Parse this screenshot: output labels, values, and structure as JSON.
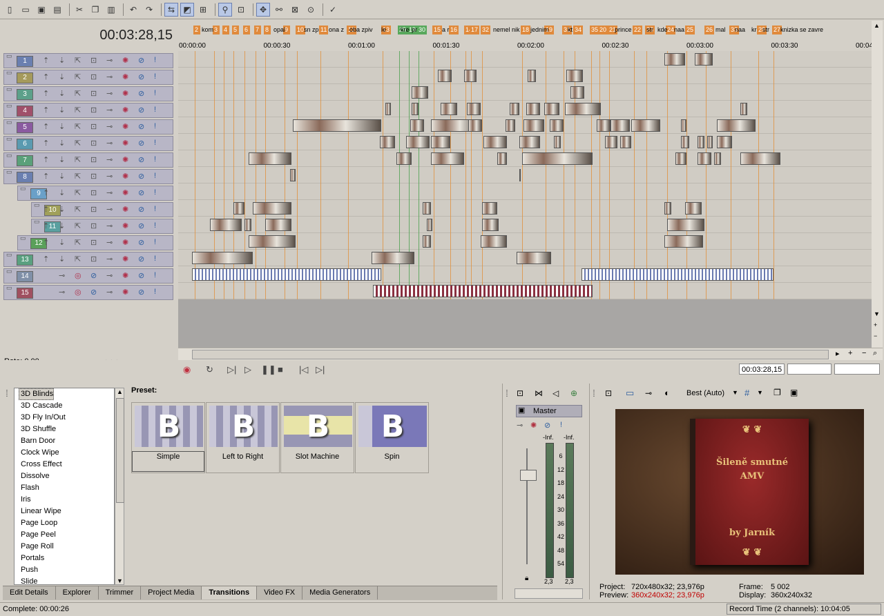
{
  "toolbar": {
    "icons": [
      "new-icon",
      "open-icon",
      "save-icon",
      "properties-icon",
      "cut-icon",
      "copy-icon",
      "paste-icon",
      "undo-icon",
      "redo-icon",
      "normal-edit-tool-icon",
      "envelope-tool-icon",
      "selection-tool-icon",
      "snapping-icon",
      "auto-ripple-icon",
      "lock-envelopes-icon",
      "ignore-grouping-icon",
      "zoom-tool-icon",
      "crossfade-icon"
    ]
  },
  "timeline": {
    "cursor_time": "00:03:28,15",
    "rate_label": "Rate: 0,00",
    "ruler_ticks": [
      "00:00:00",
      "00:00:30",
      "00:01:00",
      "00:01:30",
      "00:02:00",
      "00:02:30",
      "00:03:00",
      "00:03:30",
      "00:04:0"
    ],
    "markers": [
      "2",
      "3",
      "4",
      "5",
      "6",
      "7",
      "8",
      "9",
      "10",
      "11",
      "12",
      "13",
      "29",
      "19",
      "30",
      "15",
      "16",
      "14",
      "17",
      "32",
      "18",
      "19",
      "31",
      "34",
      "35",
      "20",
      "21",
      "22",
      "23",
      "24",
      "25",
      "26",
      "33",
      "28",
      "27"
    ],
    "marker_texts": [
      "kom",
      "opal",
      "sn zp",
      "ona z",
      "oba zpiv",
      "le",
      "kre",
      "pr",
      "a r",
      "nemel nik",
      "jednim",
      "kt",
      "prince",
      "str",
      "kde",
      "naa",
      "mal",
      "naa",
      "kr",
      "str",
      "knizka se zavre"
    ],
    "tracks": [
      "1",
      "2",
      "3",
      "4",
      "5",
      "6",
      "7",
      "8",
      "9",
      "10",
      "11",
      "12",
      "13",
      "14",
      "15"
    ],
    "transport_time": "00:03:28,15"
  },
  "transitions": {
    "preset_label": "Preset:",
    "list": [
      "3D Blinds",
      "3D Cascade",
      "3D Fly In/Out",
      "3D Shuffle",
      "Barn Door",
      "Clock Wipe",
      "Cross Effect",
      "Dissolve",
      "Flash",
      "Iris",
      "Linear Wipe",
      "Page Loop",
      "Page Peel",
      "Page Roll",
      "Portals",
      "Push",
      "Slide"
    ],
    "selected": "3D Blinds",
    "presets": [
      "Simple",
      "Left to Right",
      "Slot Machine",
      "Spin"
    ]
  },
  "tabs": [
    "Edit Details",
    "Explorer",
    "Trimmer",
    "Project Media",
    "Transitions",
    "Video FX",
    "Media Generators"
  ],
  "active_tab": "Transitions",
  "mixer": {
    "master_label": "Master",
    "inf_left": "-Inf.",
    "inf_right": "-Inf.",
    "scale": [
      "6",
      "12",
      "18",
      "24",
      "30",
      "36",
      "42",
      "48",
      "54"
    ],
    "value_left": "2,3",
    "value_right": "2,3"
  },
  "preview": {
    "quality": "Best (Auto)",
    "book_title_line1": "Šileně smutné",
    "book_title_line2": "AMV",
    "book_author": "by Jarník",
    "project_label": "Project:",
    "project_value": "720x480x32; 23,976p",
    "preview_label": "Preview:",
    "preview_value": "360x240x32; 23,976p",
    "frame_label": "Frame:",
    "frame_value": "5 002",
    "display_label": "Display:",
    "display_value": "360x240x32"
  },
  "status": {
    "left": "Complete: 00:00:26",
    "right": "Record Time (2 channels): 10:04:05"
  },
  "colors": {
    "marker_orange": "#e08a3c",
    "marker_green": "#58a85c",
    "track_colors": [
      "#6a7fb0",
      "#a59a5c",
      "#5ca08a",
      "#a0506a",
      "#8a5aa0",
      "#5a9ab0",
      "#5aa07a",
      "#6a7fb0",
      "#6aa0c8",
      "#a0a05a",
      "#5aa0a0",
      "#5aa05a",
      "#5aa080",
      "#8090a8",
      "#a05060"
    ]
  }
}
